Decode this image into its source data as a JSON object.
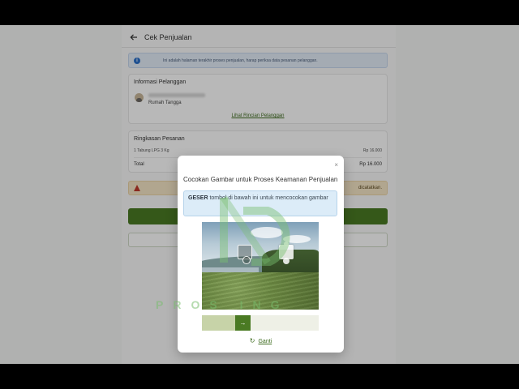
{
  "header": {
    "title": "Cek Penjualan"
  },
  "info_banner": {
    "text": "Ini adalah halaman terakhir proses penjualan, harap periksa data pesanan pelanggan."
  },
  "customer_card": {
    "title": "Informasi Pelanggan",
    "customer_type": "Rumah Tangga",
    "detail_link": "Lihat Rincian Pelanggan"
  },
  "summary_card": {
    "title": "Ringkasan Pesanan",
    "item_label": "1 Tabung LPG 3 Kg",
    "item_price": "Rp 16.000",
    "total_label": "Total",
    "total_price": "Rp 16.000"
  },
  "warning_banner": {
    "text": "dicatatkan."
  },
  "modal": {
    "title": "Cocokan Gambar untuk Proses Keamanan Penjualan",
    "instruction_bold": "GESER",
    "instruction_rest": " tombol di bawah ini untuk mencocokan gambar",
    "slider_progress": 0.33,
    "refresh_label": "Ganti",
    "close_symbol": "×",
    "handle_symbol": "→"
  },
  "watermark": {
    "text": "PROS         ING"
  },
  "icons": {
    "back": "arrow-left-icon",
    "info": "info-icon",
    "warning": "warning-triangle-icon",
    "refresh": "refresh-icon",
    "close": "close-icon",
    "slider": "arrow-right-icon"
  },
  "colors": {
    "brand_green": "#4a7a23",
    "info_blue": "#2a6fc9",
    "warning_red": "#c0392b"
  }
}
